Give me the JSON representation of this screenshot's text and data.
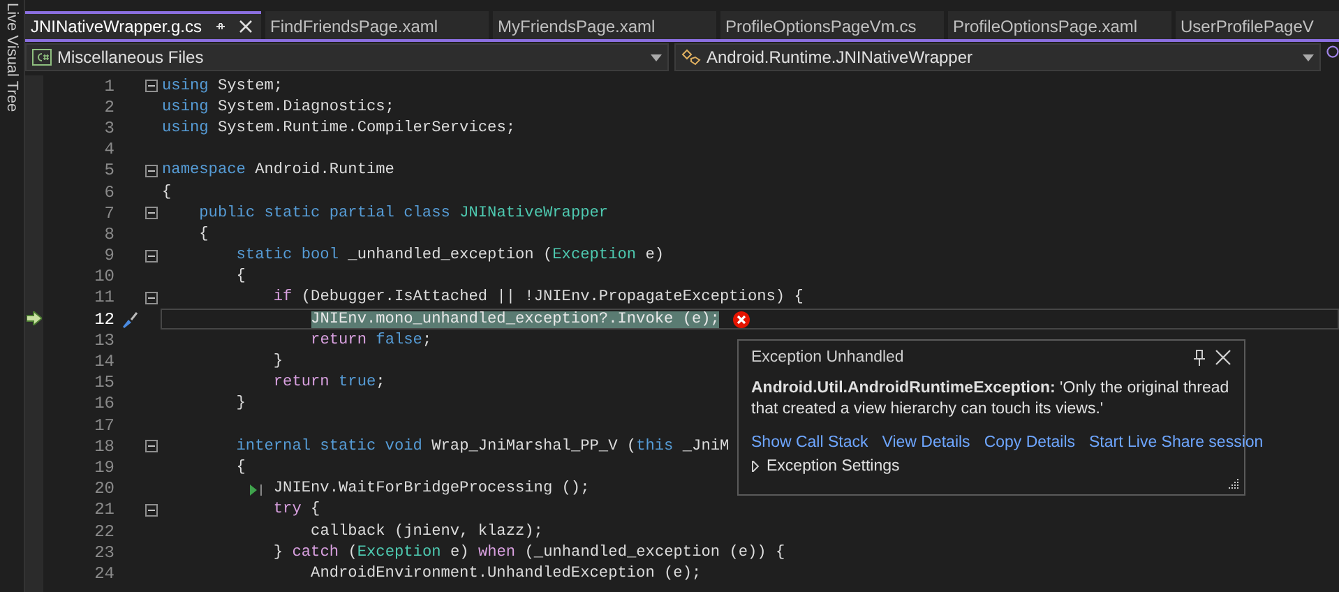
{
  "side_panel": {
    "label": "Live Visual Tree"
  },
  "tabs": [
    {
      "label": "JNINativeWrapper.g.cs",
      "selected": true
    },
    {
      "label": "FindFriendsPage.xaml",
      "selected": false
    },
    {
      "label": "MyFriendsPage.xaml",
      "selected": false
    },
    {
      "label": "ProfileOptionsPageVm.cs",
      "selected": false
    },
    {
      "label": "ProfileOptionsPage.xaml",
      "selected": false
    },
    {
      "label": "UserProfilePageV",
      "selected": false
    }
  ],
  "navigation": {
    "project": "Miscellaneous Files",
    "member": "Android.Runtime.JNINativeWrapper"
  },
  "code_lines": [
    {
      "number": "1",
      "fold": true,
      "current": false,
      "run_marker": false,
      "tokens": [
        {
          "text": "using",
          "kind": "keyword"
        },
        {
          "text": " System;",
          "kind": "text"
        }
      ]
    },
    {
      "number": "2",
      "fold": false,
      "current": false,
      "run_marker": false,
      "tokens": [
        {
          "text": "using",
          "kind": "keyword"
        },
        {
          "text": " System.Diagnostics;",
          "kind": "text"
        }
      ]
    },
    {
      "number": "3",
      "fold": false,
      "current": false,
      "run_marker": false,
      "tokens": [
        {
          "text": "using",
          "kind": "keyword"
        },
        {
          "text": " System.Runtime.CompilerServices;",
          "kind": "text"
        }
      ]
    },
    {
      "number": "4",
      "fold": false,
      "current": false,
      "run_marker": false
    },
    {
      "number": "5",
      "fold": true,
      "current": false,
      "run_marker": false,
      "tokens": [
        {
          "text": "namespace",
          "kind": "keyword"
        },
        {
          "text": " Android.Runtime",
          "kind": "text"
        }
      ]
    },
    {
      "number": "6",
      "fold": false,
      "current": false,
      "run_marker": false,
      "tokens": [
        {
          "text": "{",
          "kind": "text"
        }
      ]
    },
    {
      "number": "7",
      "fold": true,
      "current": false,
      "run_marker": false,
      "tokens": [
        {
          "text": "    public static partial class",
          "kind": "keyword"
        },
        {
          "text": " JNINativeWrapper",
          "kind": "type"
        }
      ]
    },
    {
      "number": "8",
      "fold": false,
      "current": false,
      "run_marker": false,
      "tokens": [
        {
          "text": "    {",
          "kind": "text"
        }
      ]
    },
    {
      "number": "9",
      "fold": true,
      "current": false,
      "run_marker": false,
      "tokens": [
        {
          "text": "        static bool",
          "kind": "keyword"
        },
        {
          "text": " _unhandled_exception (",
          "kind": "text"
        },
        {
          "text": "Exception",
          "kind": "type"
        },
        {
          "text": " e)",
          "kind": "text"
        }
      ]
    },
    {
      "number": "10",
      "fold": false,
      "current": false,
      "run_marker": false,
      "tokens": [
        {
          "text": "        {",
          "kind": "text"
        }
      ]
    },
    {
      "number": "11",
      "fold": true,
      "current": false,
      "run_marker": false,
      "tokens": [
        {
          "text": "            if",
          "kind": "control"
        },
        {
          "text": " (Debugger.IsAttached || !JNIEnv.PropagateExceptions) {",
          "kind": "text"
        }
      ]
    },
    {
      "number": "12",
      "fold": false,
      "current": true,
      "run_marker": false,
      "tokens": [
        {
          "text": "                JNIEnv.mono_unhandled_exception?.Invoke (e);",
          "kind": "highlight"
        }
      ]
    },
    {
      "number": "13",
      "fold": false,
      "current": false,
      "run_marker": false,
      "tokens": [
        {
          "text": "                return",
          "kind": "control"
        },
        {
          "text": " false",
          "kind": "keyword"
        },
        {
          "text": ";",
          "kind": "text"
        }
      ]
    },
    {
      "number": "14",
      "fold": false,
      "current": false,
      "run_marker": false,
      "tokens": [
        {
          "text": "            }",
          "kind": "text"
        }
      ]
    },
    {
      "number": "15",
      "fold": false,
      "current": false,
      "run_marker": false,
      "tokens": [
        {
          "text": "            return",
          "kind": "control"
        },
        {
          "text": " true",
          "kind": "keyword"
        },
        {
          "text": ";",
          "kind": "text"
        }
      ]
    },
    {
      "number": "16",
      "fold": false,
      "current": false,
      "run_marker": false,
      "tokens": [
        {
          "text": "        }",
          "kind": "text"
        }
      ]
    },
    {
      "number": "17",
      "fold": false,
      "current": false,
      "run_marker": false
    },
    {
      "number": "18",
      "fold": true,
      "current": false,
      "run_marker": false,
      "tokens": [
        {
          "text": "        internal static void",
          "kind": "keyword"
        },
        {
          "text": " Wrap_JniMarshal_PP_V (",
          "kind": "text"
        },
        {
          "text": "this",
          "kind": "keyword"
        },
        {
          "text": " _JniM",
          "kind": "text"
        }
      ]
    },
    {
      "number": "19",
      "fold": false,
      "current": false,
      "run_marker": false,
      "tokens": [
        {
          "text": "        {",
          "kind": "text"
        }
      ]
    },
    {
      "number": "20",
      "fold": false,
      "current": false,
      "run_marker": true,
      "tokens": [
        {
          "text": "            JNIEnv.WaitForBridgeProcessing ();",
          "kind": "text"
        }
      ]
    },
    {
      "number": "21",
      "fold": true,
      "current": false,
      "run_marker": false,
      "tokens": [
        {
          "text": "            try",
          "kind": "control"
        },
        {
          "text": " {",
          "kind": "text"
        }
      ]
    },
    {
      "number": "22",
      "fold": false,
      "current": false,
      "run_marker": false,
      "tokens": [
        {
          "text": "                callback (jnienv, klazz);",
          "kind": "text"
        }
      ]
    },
    {
      "number": "23",
      "fold": false,
      "current": false,
      "run_marker": false,
      "tokens": [
        {
          "text": "            } ",
          "kind": "text"
        },
        {
          "text": "catch",
          "kind": "control"
        },
        {
          "text": " (",
          "kind": "text"
        },
        {
          "text": "Exception",
          "kind": "type"
        },
        {
          "text": " e) ",
          "kind": "text"
        },
        {
          "text": "when",
          "kind": "control"
        },
        {
          "text": " (_unhandled_exception (e)) {",
          "kind": "text"
        }
      ]
    },
    {
      "number": "24",
      "fold": false,
      "current": false,
      "run_marker": false,
      "tokens": [
        {
          "text": "                AndroidEnvironment.UnhandledException (e);",
          "kind": "text"
        }
      ]
    }
  ],
  "exception_popup": {
    "title": "Exception Unhandled",
    "message": "**Android.Util.AndroidRuntimeException:** 'Only the original thread that created a view hierarchy can touch its views.'",
    "links": [
      "Show Call Stack",
      "View Details",
      "Copy Details",
      "Start Live Share session"
    ],
    "settings": {
      "label": "Exception Settings",
      "expanded": false
    }
  }
}
